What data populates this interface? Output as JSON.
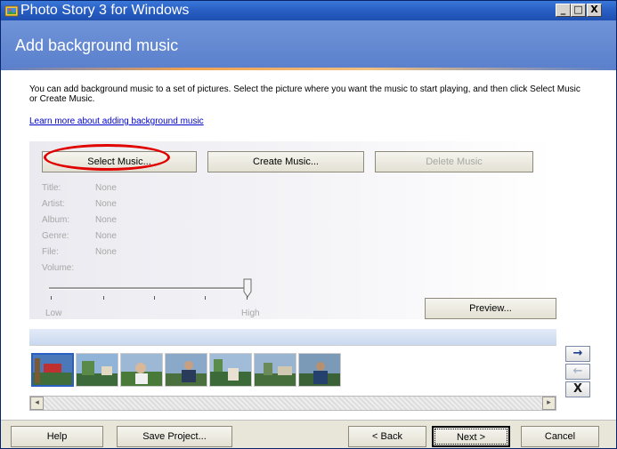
{
  "window": {
    "title": "Photo Story 3 for Windows",
    "controls": {
      "minimize": "_",
      "maximize": "□",
      "close": "X"
    }
  },
  "header": {
    "heading": "Add background music"
  },
  "content": {
    "description": "You can add background music to a set of pictures.  Select the picture where you want the music to start playing, and then click Select Music or Create Music.",
    "learn_link": "Learn more about adding background music"
  },
  "music_buttons": {
    "select": {
      "label": "Select Music...",
      "mnemonic": "e"
    },
    "create": {
      "label": "Create Music...",
      "mnemonic": "C"
    },
    "delete": {
      "label": "Delete Music",
      "mnemonic": "u",
      "enabled": false
    }
  },
  "music_info": [
    {
      "label": "Title:",
      "value": "None"
    },
    {
      "label": "Artist:",
      "value": "None"
    },
    {
      "label": "Album:",
      "value": "None"
    },
    {
      "label": "Genre:",
      "value": "None"
    },
    {
      "label": "File:",
      "value": "None"
    }
  ],
  "volume": {
    "label": "Volume:",
    "low_label": "Low",
    "high_label": "High",
    "level": 1.0
  },
  "preview_button": "Preview...",
  "filmstrip": {
    "thumbnail_count": 7,
    "selected_index": 0
  },
  "side_buttons": {
    "move_right": "→",
    "move_left": "←",
    "remove": "X"
  },
  "bottom_buttons": {
    "help": "Help",
    "save": "Save Project...",
    "back": "< Back",
    "next": "Next >",
    "cancel": "Cancel"
  },
  "colors": {
    "title_bar": "#2a5fc4",
    "header": "#6f94d8",
    "annotation": "#e00000",
    "link": "#0000cc"
  }
}
